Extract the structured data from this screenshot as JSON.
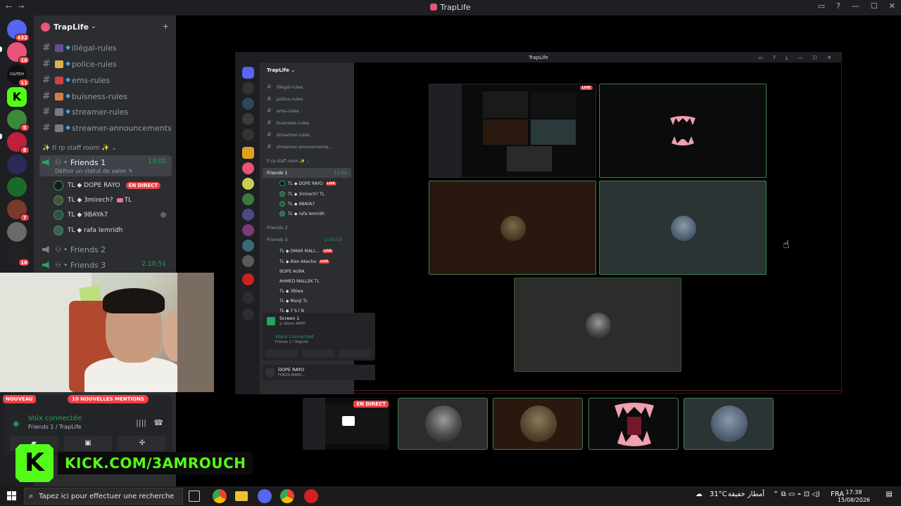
{
  "window": {
    "title": "TrapLife",
    "nav_back": "←",
    "nav_forward": "→",
    "controls": [
      "▭",
      "?",
      "—",
      "☐",
      "✕"
    ]
  },
  "rail": {
    "servers": [
      {
        "badge": "432",
        "color": "#5865f2"
      },
      {
        "badge": "10",
        "color": "#e8547a"
      },
      {
        "badge": "11",
        "color": "#111111",
        "label": "CLUTCH"
      },
      {
        "badge": "",
        "color": "#53fc18",
        "label": "K"
      },
      {
        "badge": "5",
        "color": "#3a8a3a"
      },
      {
        "badge": "8",
        "color": "#c0203a"
      },
      {
        "badge": "",
        "color": "#2a2a5a"
      },
      {
        "badge": "",
        "color": "#1c6a2a"
      },
      {
        "badge": "7",
        "color": "#7a3a2a"
      },
      {
        "badge": "",
        "color": "#6a6a6a"
      },
      {
        "badge": "16",
        "color": "#222222"
      }
    ]
  },
  "sidebar": {
    "guild_name": "TrapLife",
    "caret": "⌄",
    "invite_icon": "+",
    "channels": [
      {
        "name": "illégal-rules",
        "color": "#6a4a9a"
      },
      {
        "name": "police-rules",
        "color": "#e0b050"
      },
      {
        "name": "ems-rules",
        "color": "#d04040"
      },
      {
        "name": "buisness-rules",
        "color": "#d08040"
      },
      {
        "name": "streamer-rules",
        "color": "#7a7a8a"
      },
      {
        "name": "streamer-announcements",
        "color": "#7a7a8a"
      }
    ],
    "category": "✨ tl rp staff room ✨ ⌄",
    "voice": {
      "friends1": {
        "name": "Friends 1",
        "time": "13:02",
        "status": "Définir un statut de salon ✎"
      },
      "friends2": {
        "name": "Friends 2"
      },
      "friends3": {
        "name": "Friends 3",
        "time": "2:10:51"
      }
    },
    "members": [
      {
        "name": "TL ◆ DOPE RAYO",
        "live": "EN DIRECT",
        "color": "#1a1a1a"
      },
      {
        "name": "TL ◆ 3mirech?",
        "tag": "TL",
        "color": "#5a4a3a"
      },
      {
        "name": "TL ◆ 9BAYA7",
        "icon": "◎",
        "color": "#3a4a4a"
      },
      {
        "name": "TL ◆ rafa lemridh",
        "color": "#4a5a5a"
      }
    ]
  },
  "notices": {
    "nouveau": "NOUVEAU",
    "mentions": "10 NOUVELLES MENTIONS"
  },
  "voice_panel": {
    "status": "Voix connectée",
    "channel": "Friends 1 / TrapLife",
    "wave_icon": "||||",
    "hang_icon": "☎",
    "btn_cam": "▰",
    "btn_screen": "▣",
    "btn_activity": "✣"
  },
  "kick": {
    "logo": "K",
    "url": "KICK.COM/3AMROUCH"
  },
  "nested": {
    "title": "TrapLife",
    "controls": "▭ ? ⤓ — ☐ ✕",
    "guild": "TrapLife ⌄",
    "channels": [
      "illégal-rules",
      "police-rules",
      "ems-rules",
      "buisness-rules",
      "streamer-rules",
      "streamer-announceme..."
    ],
    "category": "tl rp staff room ✨ ⌄",
    "friends1": "Friends 1",
    "friends1_time": "11:04",
    "members": [
      "TL ◆ DOPE RAYO",
      "TL ◆ 3mirech? TL",
      "TL ◆ 9BAYA7",
      "TL ◆ rafa lemridh"
    ],
    "live": "LIVE",
    "friends2": "Friends 2",
    "friends3": "Friends 3",
    "friends3_time": "2:10:53",
    "members3": [
      "TL ◆ OMAR MALL...",
      "TL ◆ Alex Akecha",
      "IB3PE AURA",
      "AHMED MALLEK TL",
      "TL ◆ 3Biwa",
      "TL ◆ Monji TL",
      "TL ◆ 7 S I N"
    ],
    "screen": "Screen 1",
    "screen_sub": "◎ Watch AIPPP",
    "vc": "Voice Connected",
    "vc_sub": "Friends 1 / TrapLife",
    "user": "DOPE RAYO",
    "user_sub": "FORZA BIANC..."
  },
  "stage": {
    "live_tag": "LIVE",
    "en_direct": "EN DIRECT"
  },
  "taskbar": {
    "search_placeholder": "Tapez ici pour effectuer une recherche",
    "search_icon": "⌕",
    "weather": "31°C",
    "weather_text": "أمطار خفيفة",
    "tray_icons": "⌃ ⧉ ▭ ⌁ ⊡ ◁)",
    "lang": "FRA",
    "time": "17:38",
    "date": "15/08/2026",
    "notif": "▤"
  },
  "colors": {
    "green": "#23a55a",
    "red": "#f23f43",
    "kick": "#53fc18",
    "rail": "#1e1f22",
    "sidebar": "#2b2d31"
  }
}
